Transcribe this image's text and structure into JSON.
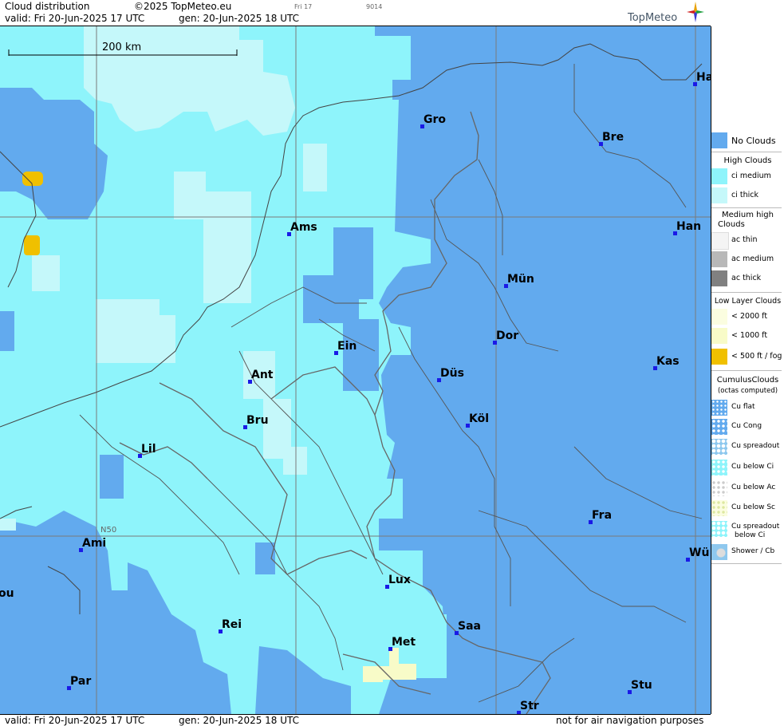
{
  "header": {
    "title": "Cloud distribution",
    "copyright": "©2025 TopMeteo.eu",
    "valid": "valid:  Fri  20-Jun-2025  17 UTC",
    "generated": "gen: 20-Jun-2025 18 UTC",
    "slider_day": "Fri 17",
    "code": "9014",
    "brand": "TopMeteo"
  },
  "footer": {
    "valid": "valid:  Fri  20-Jun-2025  17 UTC",
    "generated": "gen: 20-Jun-2025 18 UTC",
    "disclaimer": "not for air navigation purposes"
  },
  "map": {
    "scale_label": "200 km",
    "lat_label": "N50",
    "colors": {
      "no_clouds": "#62aaee",
      "ci_medium": "#8ef4fb",
      "ci_thick": "#c5f8fa",
      "low_fog": "#f0c000",
      "low_1000": "#f8fbc8"
    },
    "cities": [
      {
        "name": "Ha"
      },
      {
        "name": "Gro"
      },
      {
        "name": "Bre"
      },
      {
        "name": "Ams"
      },
      {
        "name": "Han"
      },
      {
        "name": "Mün"
      },
      {
        "name": "Ein"
      },
      {
        "name": "Dor"
      },
      {
        "name": "Kas"
      },
      {
        "name": "Ant"
      },
      {
        "name": "Düs"
      },
      {
        "name": "Köl"
      },
      {
        "name": "Bru"
      },
      {
        "name": "Lil"
      },
      {
        "name": "Fra"
      },
      {
        "name": "Ami"
      },
      {
        "name": "Wü"
      },
      {
        "name": "Lux"
      },
      {
        "name": "ou"
      },
      {
        "name": "Rei"
      },
      {
        "name": "Saa"
      },
      {
        "name": "Met"
      },
      {
        "name": "Par"
      },
      {
        "name": "Stu"
      },
      {
        "name": "Str"
      }
    ]
  },
  "legend": {
    "no_clouds": "No Clouds",
    "high_title": "High Clouds",
    "ci_medium": "ci medium",
    "ci_thick": "ci thick",
    "medium_title_1": "Medium high",
    "medium_title_2": "Clouds",
    "ac_thin": "ac thin",
    "ac_medium": "ac medium",
    "ac_thick": "ac thick",
    "low_title": "Low Layer Clouds",
    "low_2000": "< 2000 ft",
    "low_1000": "< 1000 ft",
    "low_500": "< 500 ft / fog",
    "cu_title": "CumulusClouds",
    "cu_sub": "(octas computed)",
    "cu_flat": "Cu flat",
    "cu_cong": "Cu Cong",
    "cu_spreadout": "Cu spreadout",
    "cu_below_ci": "Cu below Ci",
    "cu_below_ac": "Cu below Ac",
    "cu_below_sc": "Cu below Sc",
    "cu_spread_ci_1": "Cu spreadout",
    "cu_spread_ci_2": "below Ci",
    "shower": "Shower / Cb"
  }
}
